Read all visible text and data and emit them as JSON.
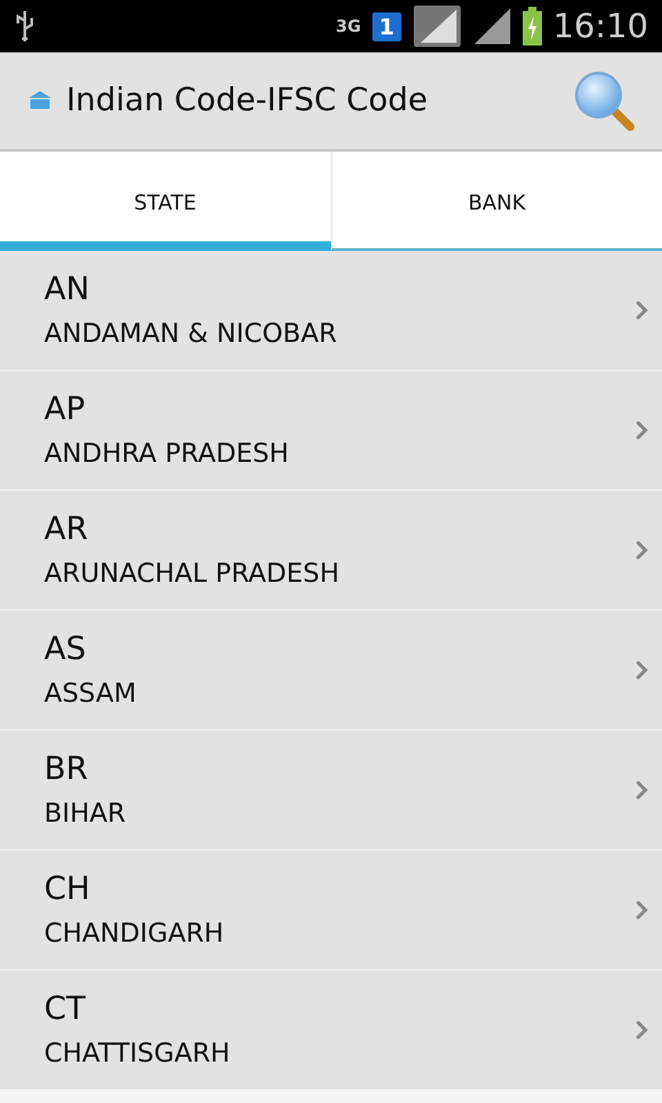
{
  "status_bar": {
    "network": "3G",
    "sim": "1",
    "time": "16:10"
  },
  "app_bar": {
    "title": "Indian Code-IFSC Code"
  },
  "tabs": [
    {
      "label": "STATE",
      "selected": true
    },
    {
      "label": "BANK",
      "selected": false
    }
  ],
  "states": [
    {
      "code": "AN",
      "name": "ANDAMAN & NICOBAR"
    },
    {
      "code": "AP",
      "name": "ANDHRA PRADESH"
    },
    {
      "code": "AR",
      "name": "ARUNACHAL PRADESH"
    },
    {
      "code": "AS",
      "name": "ASSAM"
    },
    {
      "code": "BR",
      "name": "BIHAR"
    },
    {
      "code": "CH",
      "name": "CHANDIGARH"
    },
    {
      "code": "CT",
      "name": "CHATTISGARH"
    }
  ]
}
